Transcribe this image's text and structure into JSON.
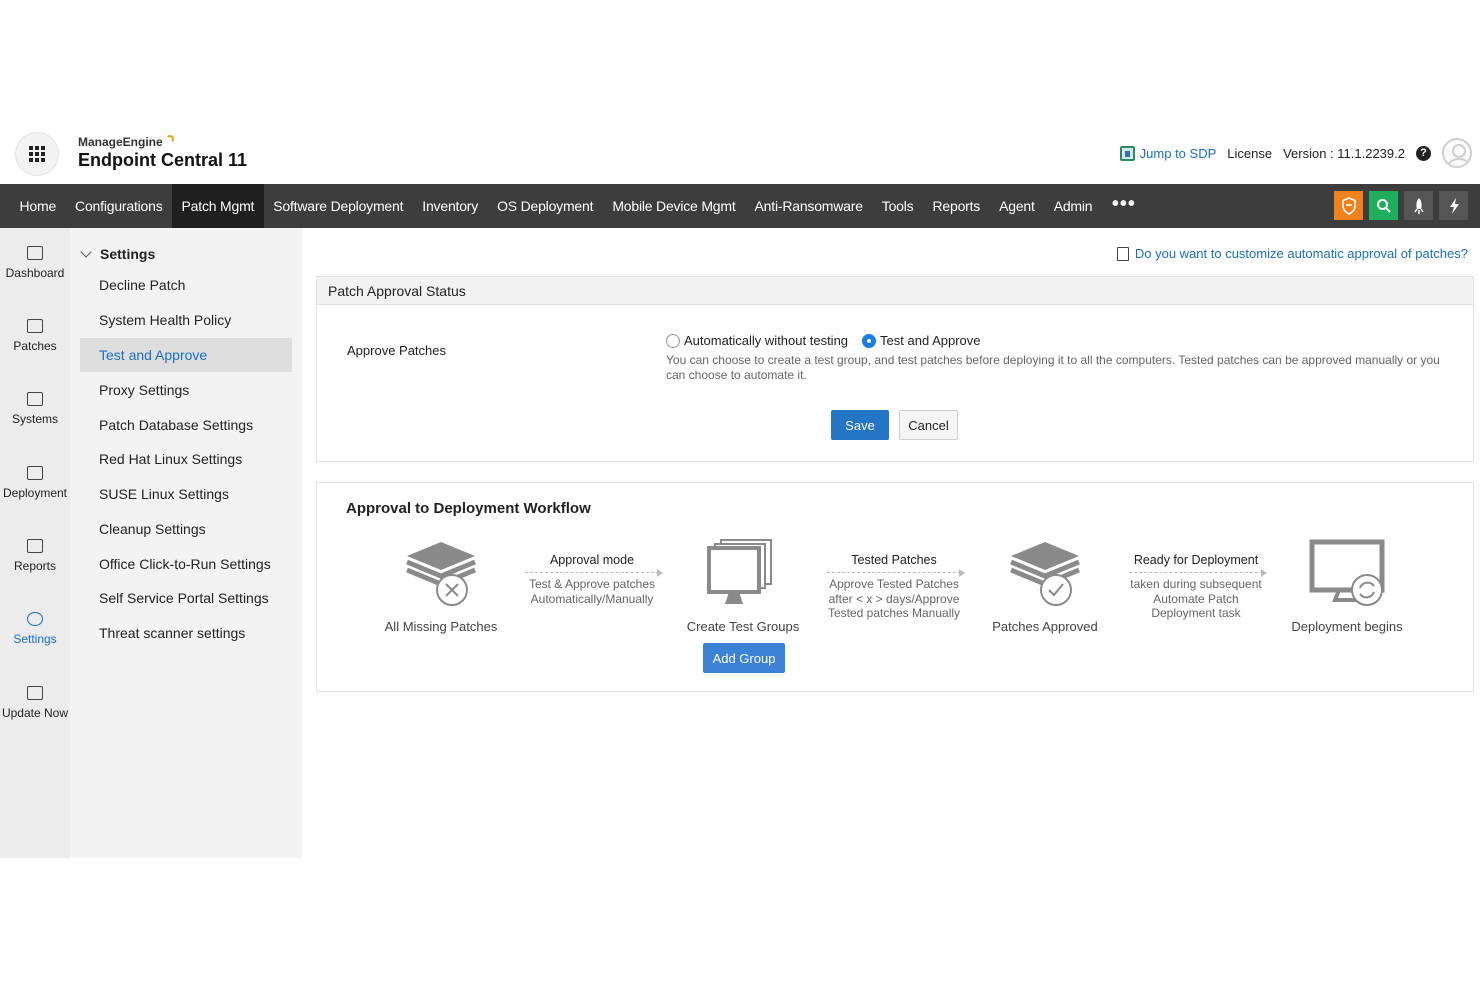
{
  "brand": {
    "company": "ManageEngine",
    "product": "Endpoint Central 11"
  },
  "header": {
    "jump_label": "Jump to SDP",
    "license_label": "License",
    "version_label": "Version : 11.1.2239.2"
  },
  "nav": {
    "items": [
      "Home",
      "Configurations",
      "Patch Mgmt",
      "Software Deployment",
      "Inventory",
      "OS Deployment",
      "Mobile Device Mgmt",
      "Anti-Ransomware",
      "Tools",
      "Reports",
      "Agent",
      "Admin"
    ],
    "active": "Patch Mgmt",
    "more": "•••"
  },
  "rail": {
    "items": [
      "Dashboard",
      "Patches",
      "Systems",
      "Deployment",
      "Reports",
      "Settings",
      "Update Now"
    ],
    "active": "Settings"
  },
  "side": {
    "heading": "Settings",
    "items": [
      "Decline Patch",
      "System Health Policy",
      "Test and Approve",
      "Proxy Settings",
      "Patch Database Settings",
      "Red Hat Linux Settings",
      "SUSE Linux Settings",
      "Cleanup Settings",
      "Office Click-to-Run Settings",
      "Self Service Portal Settings",
      "Threat scanner settings"
    ],
    "active": "Test and Approve"
  },
  "main": {
    "top_link": "Do you want to customize automatic approval of patches?",
    "panel1": {
      "title": "Patch Approval Status",
      "approve_label": "Approve Patches",
      "option_auto": "Automatically without testing",
      "option_test": "Test and Approve",
      "selected": "Test and Approve",
      "description": "You can choose to create a test group, and test patches before deploying it to all the computers. Tested patches can be approved manually or you can choose to automate it.",
      "save": "Save",
      "cancel": "Cancel"
    },
    "panel2": {
      "title": "Approval to Deployment Workflow",
      "steps": [
        "All Missing Patches",
        "Create Test Groups",
        "Patches Approved",
        "Deployment begins"
      ],
      "arrows": [
        {
          "head": "Approval mode",
          "desc1": "Test & Approve patches",
          "desc2": "Automatically/Manually",
          "desc3": ""
        },
        {
          "head": "Tested Patches",
          "desc1": "Approve Tested Patches",
          "desc2": "after < x > days/Approve",
          "desc3": "Tested patches Manually"
        },
        {
          "head": "Ready for Deployment",
          "desc1": "taken during subsequent",
          "desc2": "Automate Patch",
          "desc3": "Deployment task"
        }
      ],
      "add_group": "Add Group"
    }
  },
  "colors": {
    "accent": "#1a6fc4",
    "navbar": "#3d3d3d",
    "nav_active": "#1f1f1f",
    "shield": "#f0821e",
    "search": "#1fae5b",
    "primary_button": "#2276c5"
  },
  "icons": [
    "app-grid-icon",
    "sdp-icon",
    "help-icon",
    "avatar-icon",
    "shield-icon",
    "search-icon",
    "rocket-icon",
    "bolt-icon",
    "dashboard-icon",
    "patches-icon",
    "systems-icon",
    "deployment-icon",
    "reports-icon",
    "settings-icon",
    "update-now-icon",
    "document-icon",
    "patch-stack-icon",
    "monitor-group-icon",
    "deployment-monitor-icon"
  ]
}
